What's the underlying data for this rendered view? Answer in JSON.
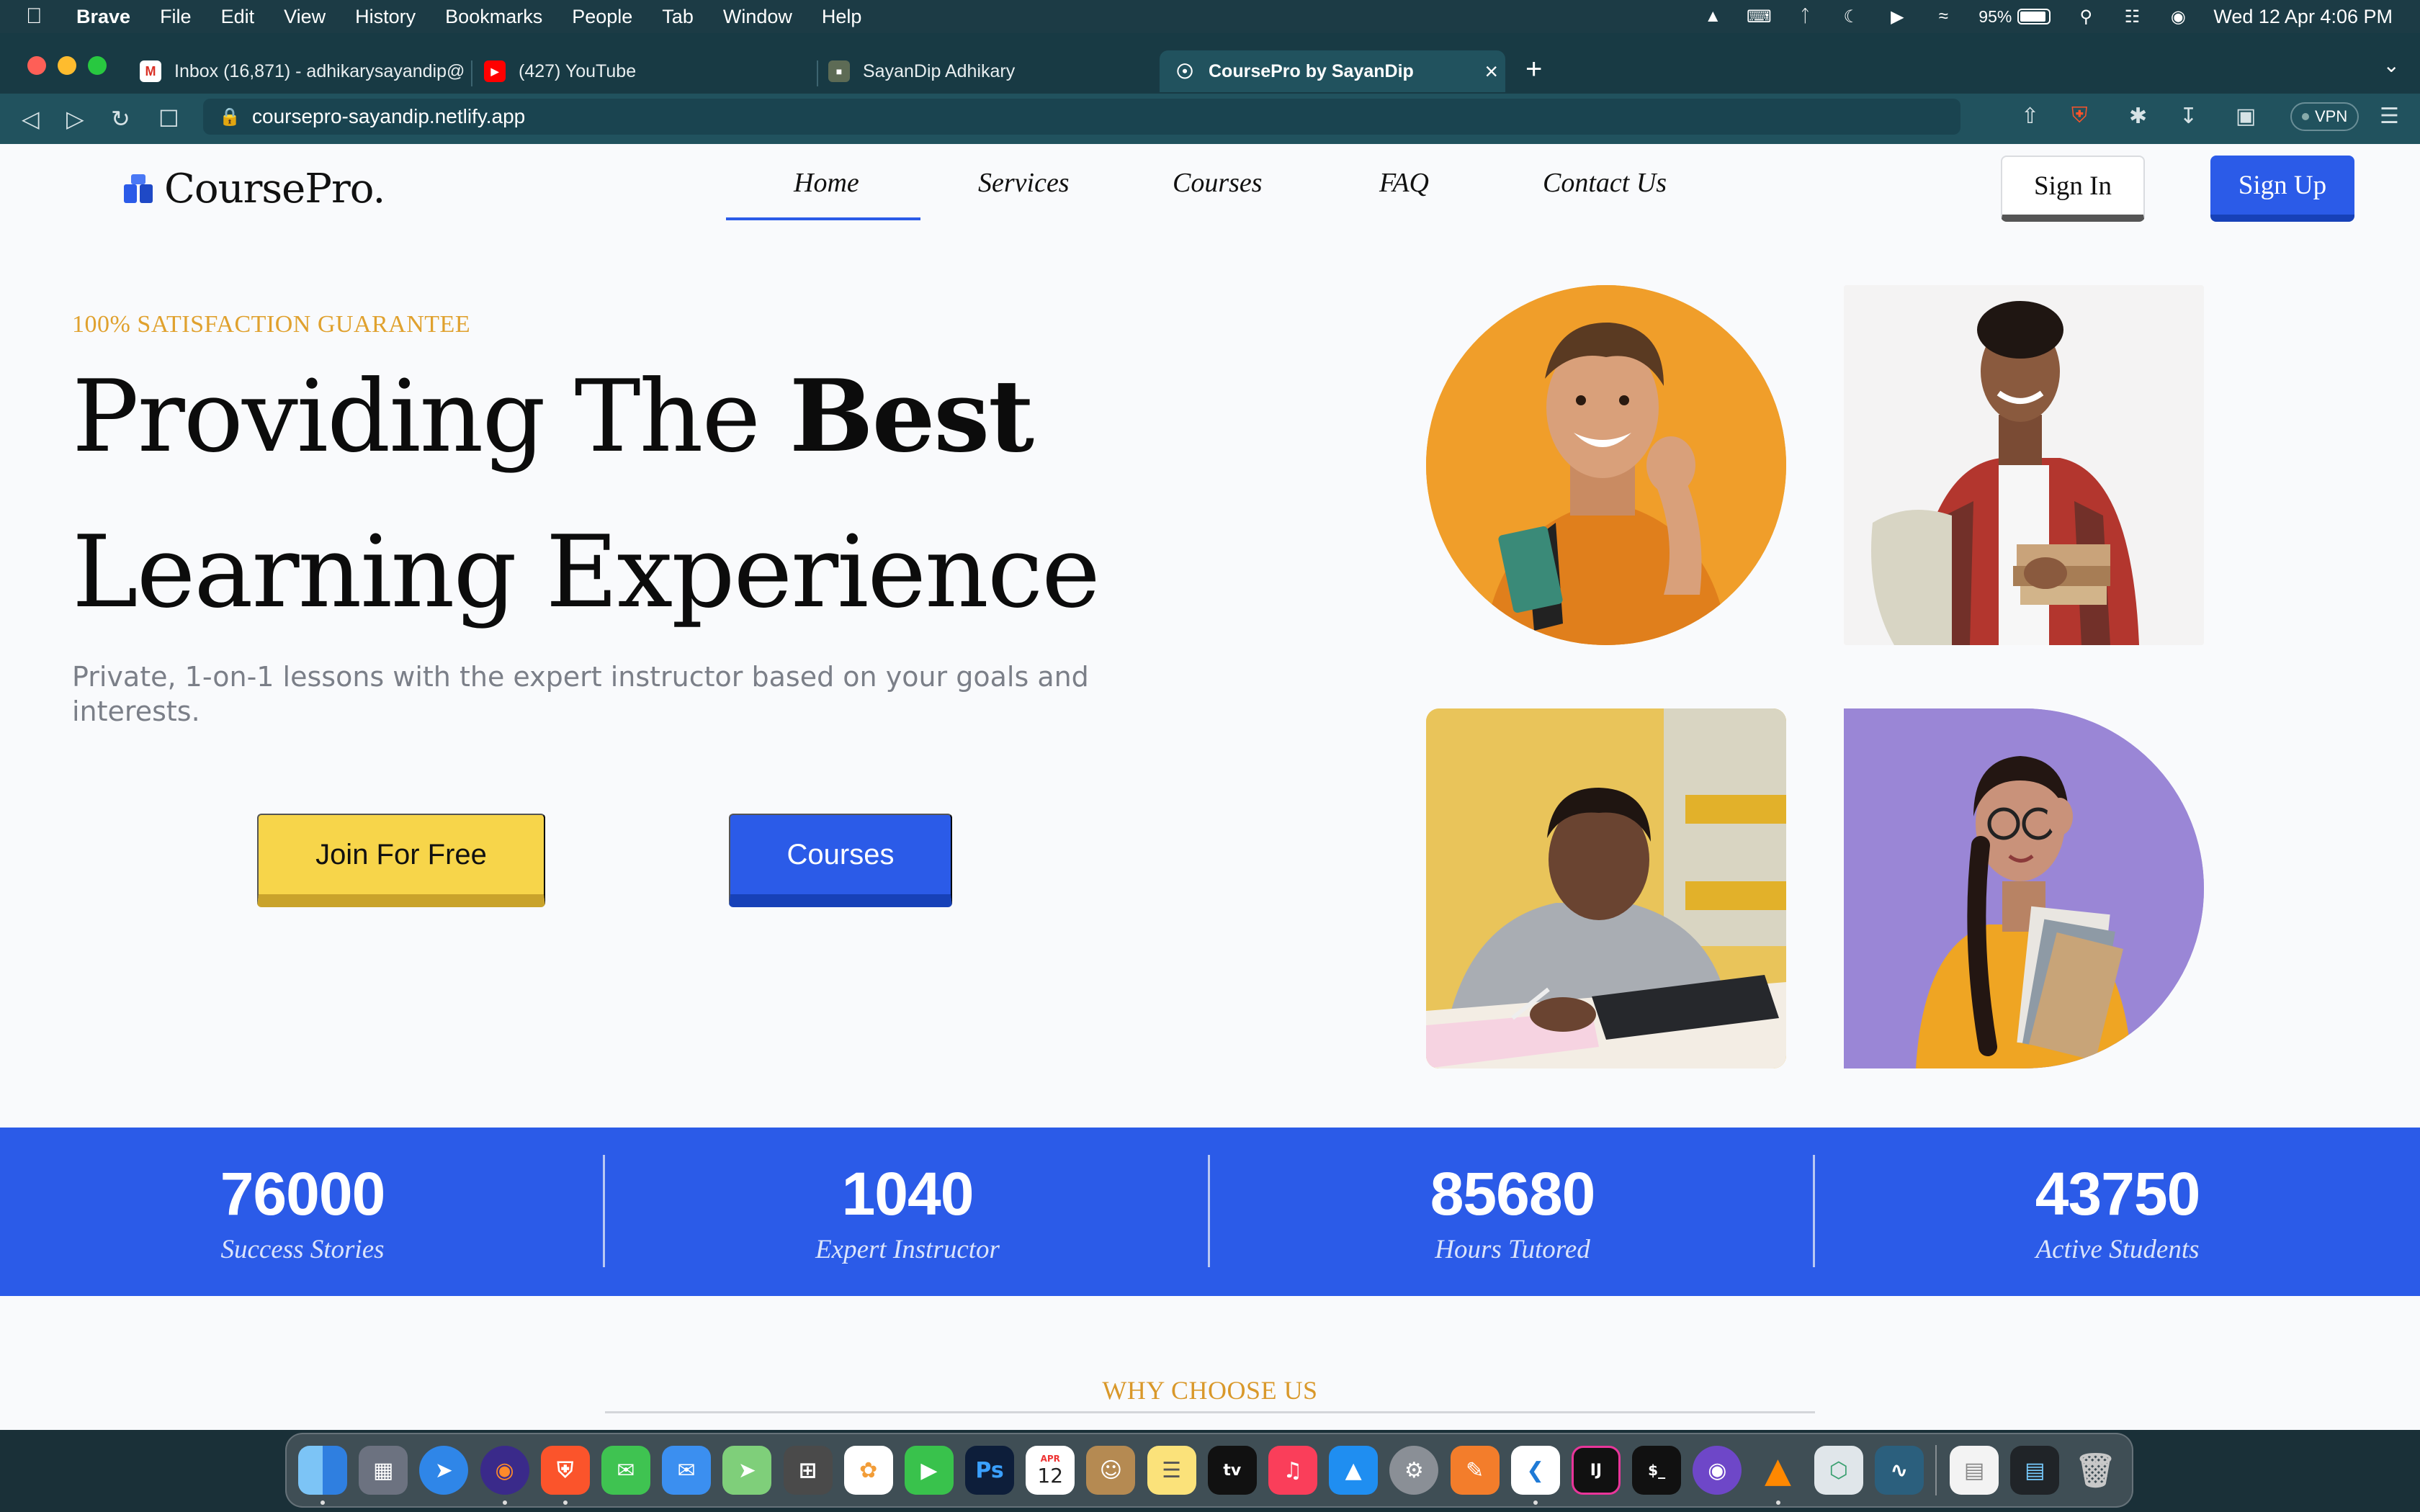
{
  "menubar": {
    "app_name": "Brave",
    "items": [
      "File",
      "Edit",
      "View",
      "History",
      "Bookmarks",
      "People",
      "Tab",
      "Window",
      "Help"
    ],
    "battery": "95%",
    "datetime": "Wed 12 Apr  4:06 PM"
  },
  "tabs": [
    {
      "label": "Inbox (16,871) - adhikarysayandip@",
      "icon": "gmail-icon"
    },
    {
      "label": "(427) YouTube",
      "icon": "youtube-icon"
    },
    {
      "label": "SayanDip Adhikary",
      "icon": "site-icon"
    },
    {
      "label": "CoursePro by SayanDip",
      "icon": "globe-icon",
      "active": true
    }
  ],
  "browser": {
    "url": "coursepro-sayandip.netlify.app",
    "vpn_label": "VPN"
  },
  "site": {
    "logo": "CoursePro.",
    "nav": [
      "Home",
      "Services",
      "Courses",
      "FAQ",
      "Contact Us"
    ],
    "active_nav": "Home",
    "signin": "Sign In",
    "signup": "Sign Up"
  },
  "hero": {
    "eyebrow": "100% SATISFACTION GUARANTEE",
    "title_part1": "Providing The ",
    "title_bold": "Best",
    "title_line2": "Learning Experience",
    "subtitle": "Private, 1-on-1 lessons with the expert instructor based on your goals and interests.",
    "btn_join": "Join For Free",
    "btn_courses": "Courses"
  },
  "stats": [
    {
      "value": "76000",
      "label": "Success Stories"
    },
    {
      "value": "1040",
      "label": "Expert Instructor"
    },
    {
      "value": "85680",
      "label": "Hours Tutored"
    },
    {
      "value": "43750",
      "label": "Active Students"
    }
  ],
  "why": "WHY CHOOSE US",
  "colors": {
    "accent_blue": "#2b5be8",
    "accent_yellow": "#f7d54a",
    "eyebrow_gold": "#e0a12e"
  },
  "dock": [
    "finder-icon",
    "launchpad-icon",
    "safari-icon",
    "firefox-icon",
    "brave-icon",
    "messages-icon",
    "mail-icon",
    "maps-icon",
    "calculator-icon",
    "photos-icon",
    "facetime-icon",
    "photoshop-icon",
    "calendar-icon",
    "contacts-icon",
    "notes-icon",
    "apple-tv-icon",
    "music-icon",
    "app-store-icon",
    "system-settings-icon",
    "pages-icon",
    "vscode-icon",
    "intellij-icon",
    "terminal-icon",
    "github-desktop-icon",
    "vlc-icon",
    "3d-box-icon",
    "mysql-workbench-icon",
    "document-icon",
    "activity-monitor-icon",
    "trash-icon"
  ],
  "dock_labels": {
    "photoshop": "Ps",
    "calendar_month": "APR",
    "calendar_day": "12",
    "apple_tv": "tv",
    "intellij": "IJ"
  }
}
